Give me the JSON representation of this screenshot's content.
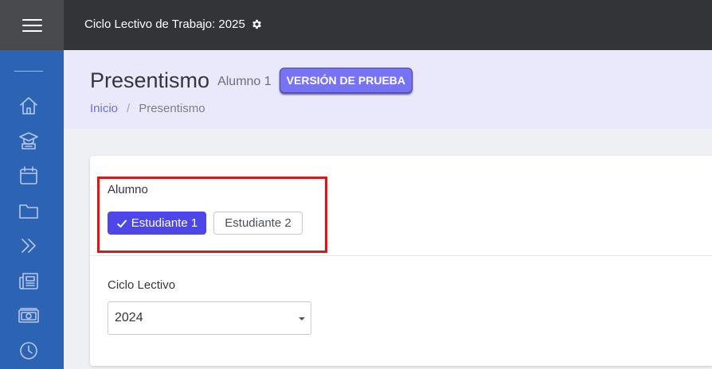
{
  "topbar": {
    "cycle_label": "Ciclo Lectivo de Trabajo: 2025"
  },
  "sidebar": {
    "items": [
      {
        "icon": "home-icon"
      },
      {
        "icon": "graduation-icon"
      },
      {
        "icon": "calendar-icon"
      },
      {
        "icon": "folder-icon"
      },
      {
        "icon": "double-chevron-right-icon"
      },
      {
        "icon": "newspaper-icon"
      },
      {
        "icon": "money-icon"
      },
      {
        "icon": "clock-icon"
      }
    ]
  },
  "header": {
    "title": "Presentismo",
    "subtitle": "Alumno 1",
    "badge": "VERSIÓN DE PRUEBA",
    "breadcrumb": {
      "home": "Inicio",
      "separator": "/",
      "current": "Presentismo"
    }
  },
  "card": {
    "student_label": "Alumno",
    "students": [
      "Estudiante 1",
      "Estudiante 2"
    ],
    "selected_student": "Estudiante 1",
    "cycle_label": "Ciclo Lectivo",
    "cycle_value": "2024"
  },
  "colors": {
    "accent": "#4d46e8",
    "badge": "#7873f5",
    "sidebar": "#2c63b2",
    "topbar": "#323438",
    "highlight": "#d11a1a"
  }
}
